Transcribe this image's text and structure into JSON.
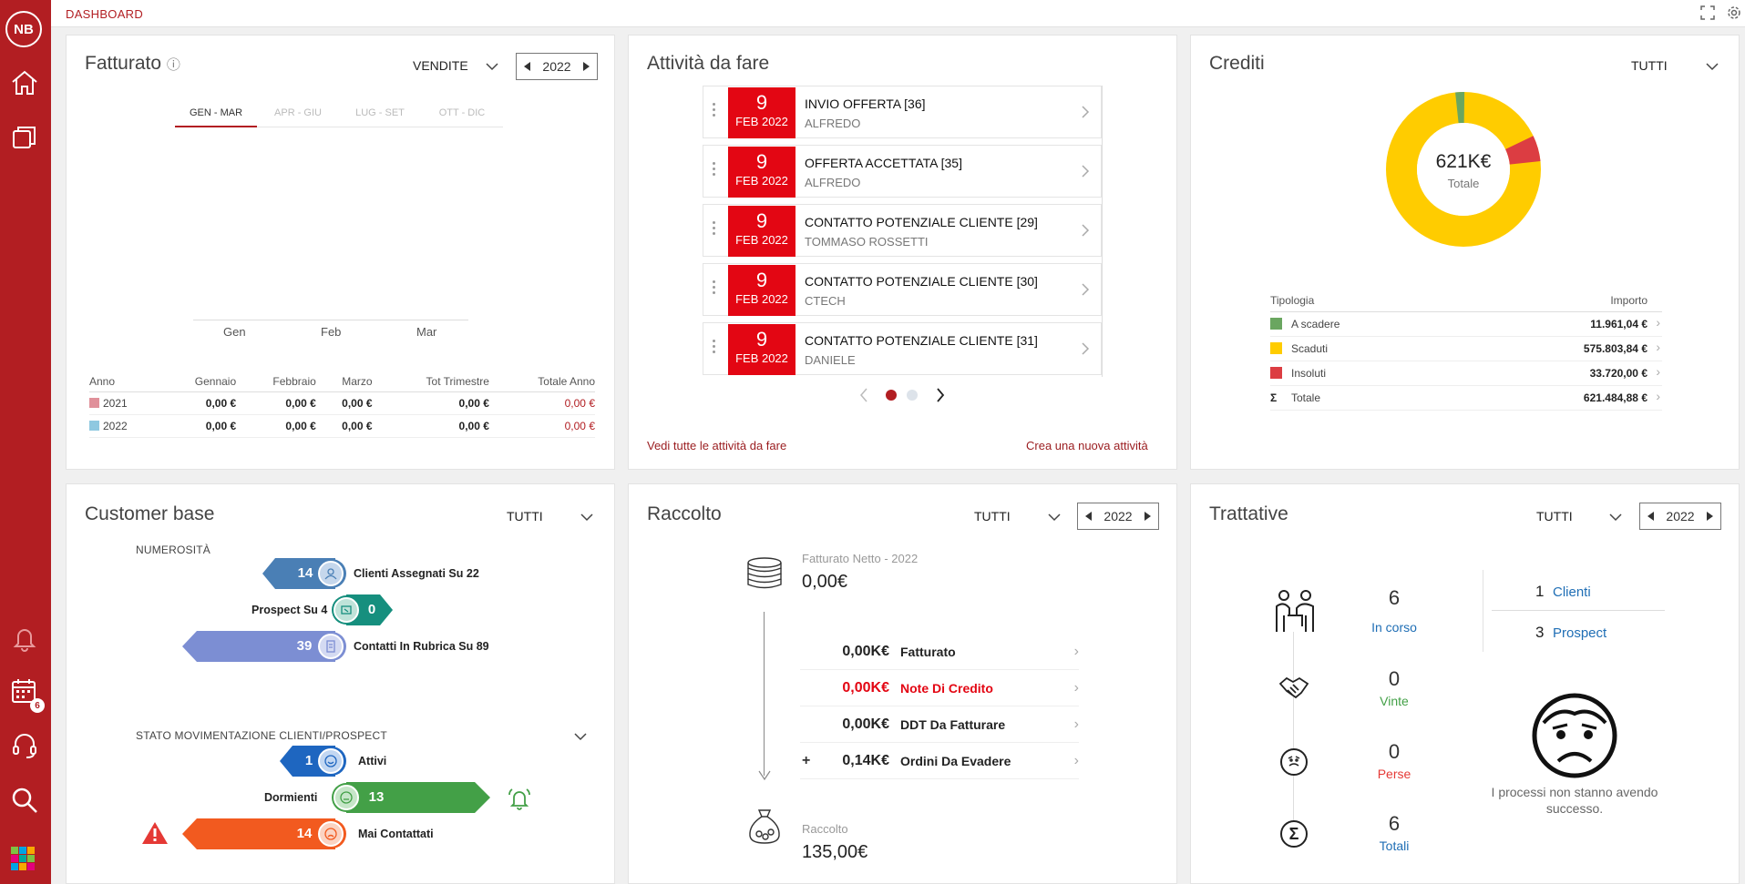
{
  "sidebar": {
    "avatar_initials": "NB",
    "calendar_badge": "6"
  },
  "topbar": {
    "breadcrumb": "DASHBOARD"
  },
  "fatturato": {
    "title": "Fatturato",
    "dropdown": "VENDITE",
    "year": "2022",
    "tabs": [
      "GEN - MAR",
      "APR - GIU",
      "LUG - SET",
      "OTT - DIC"
    ],
    "months": [
      "Gen",
      "Feb",
      "Mar"
    ],
    "table": {
      "headers": [
        "Anno",
        "Gennaio",
        "Febbraio",
        "Marzo",
        "Tot Trimestre",
        "Totale Anno"
      ],
      "rows": [
        {
          "year": "2021",
          "color": "#e0909a",
          "values": [
            "0,00 €",
            "0,00 €",
            "0,00 €",
            "0,00 €",
            "0,00 €"
          ]
        },
        {
          "year": "2022",
          "color": "#8fc8e0",
          "values": [
            "0,00 €",
            "0,00 €",
            "0,00 €",
            "0,00 €",
            "0,00 €"
          ]
        }
      ]
    }
  },
  "attivita": {
    "title": "Attività da fare",
    "items": [
      {
        "day": "9",
        "month": "FEB 2022",
        "title": "INVIO OFFERTA [36]",
        "sub": "ALFREDO"
      },
      {
        "day": "9",
        "month": "FEB 2022",
        "title": "OFFERTA ACCETTATA [35]",
        "sub": "ALFREDO"
      },
      {
        "day": "9",
        "month": "FEB 2022",
        "title": "CONTATTO POTENZIALE CLIENTE [29]",
        "sub": "TOMMASO ROSSETTI"
      },
      {
        "day": "9",
        "month": "FEB 2022",
        "title": "CONTATTO POTENZIALE CLIENTE [30]",
        "sub": "CTECH"
      },
      {
        "day": "9",
        "month": "FEB 2022",
        "title": "CONTATTO POTENZIALE CLIENTE [31]",
        "sub": "DANIELE"
      }
    ],
    "link_all": "Vedi tutte le attività da fare",
    "link_new": "Crea una nuova attività"
  },
  "crediti": {
    "title": "Crediti",
    "dropdown": "TUTTI",
    "donut_value": "621K€",
    "donut_label": "Totale",
    "table_headers": [
      "Tipologia",
      "Importo"
    ],
    "rows": [
      {
        "label": "A scadere",
        "value": "11.961,04 €",
        "color": "#6aa660"
      },
      {
        "label": "Scaduti",
        "value": "575.803,84 €",
        "color": "#ffcc00"
      },
      {
        "label": "Insoluti",
        "value": "33.720,00 €",
        "color": "#dc3d42"
      },
      {
        "label": "Totale",
        "value": "621.484,88 €",
        "symbol": "Σ"
      }
    ]
  },
  "customer": {
    "title": "Customer base",
    "dropdown": "TUTTI",
    "section1": "NUMEROSITÀ",
    "assegnati": {
      "num": "14",
      "label": "Clienti Assegnati Su 22"
    },
    "prospect": {
      "num": "0",
      "label": "Prospect Su 4"
    },
    "rubrica": {
      "num": "39",
      "label": "Contatti In Rubrica Su 89"
    },
    "section2": "STATO MOVIMENTAZIONE CLIENTI/PROSPECT",
    "attivi": {
      "num": "1",
      "label": "Attivi"
    },
    "dormienti": {
      "num": "13",
      "label": "Dormienti"
    },
    "mai": {
      "num": "14",
      "label": "Mai Contattati"
    }
  },
  "raccolto": {
    "title": "Raccolto",
    "dropdown": "TUTTI",
    "year": "2022",
    "netto_label": "Fatturato Netto - 2022",
    "netto_value": "0,00€",
    "rows": [
      {
        "prefix": "",
        "value": "0,00K€",
        "label": "Fatturato",
        "red": false
      },
      {
        "prefix": "",
        "value": "0,00K€",
        "label": "Note Di Credito",
        "red": true
      },
      {
        "prefix": "",
        "value": "0,00K€",
        "label": "DDT Da Fatturare",
        "red": false
      },
      {
        "prefix": "+",
        "value": "0,14K€",
        "label": "Ordini Da Evadere",
        "red": false
      }
    ],
    "raccolto_label": "Raccolto",
    "raccolto_value": "135,00€"
  },
  "trattative": {
    "title": "Trattative",
    "dropdown": "TUTTI",
    "year": "2022",
    "in_corso": {
      "num": "6",
      "label": "In corso"
    },
    "vinte": {
      "num": "0",
      "label": "Vinte"
    },
    "perse": {
      "num": "0",
      "label": "Perse"
    },
    "totali": {
      "num": "6",
      "label": "Totali"
    },
    "clienti": {
      "num": "1",
      "label": "Clienti"
    },
    "prospect": {
      "num": "3",
      "label": "Prospect"
    },
    "message": "I processi non stanno avendo successo."
  },
  "colors": {
    "brand": "#b21e22",
    "link_blue": "#1f6eb5",
    "green": "#43a047",
    "red": "#e53935"
  }
}
